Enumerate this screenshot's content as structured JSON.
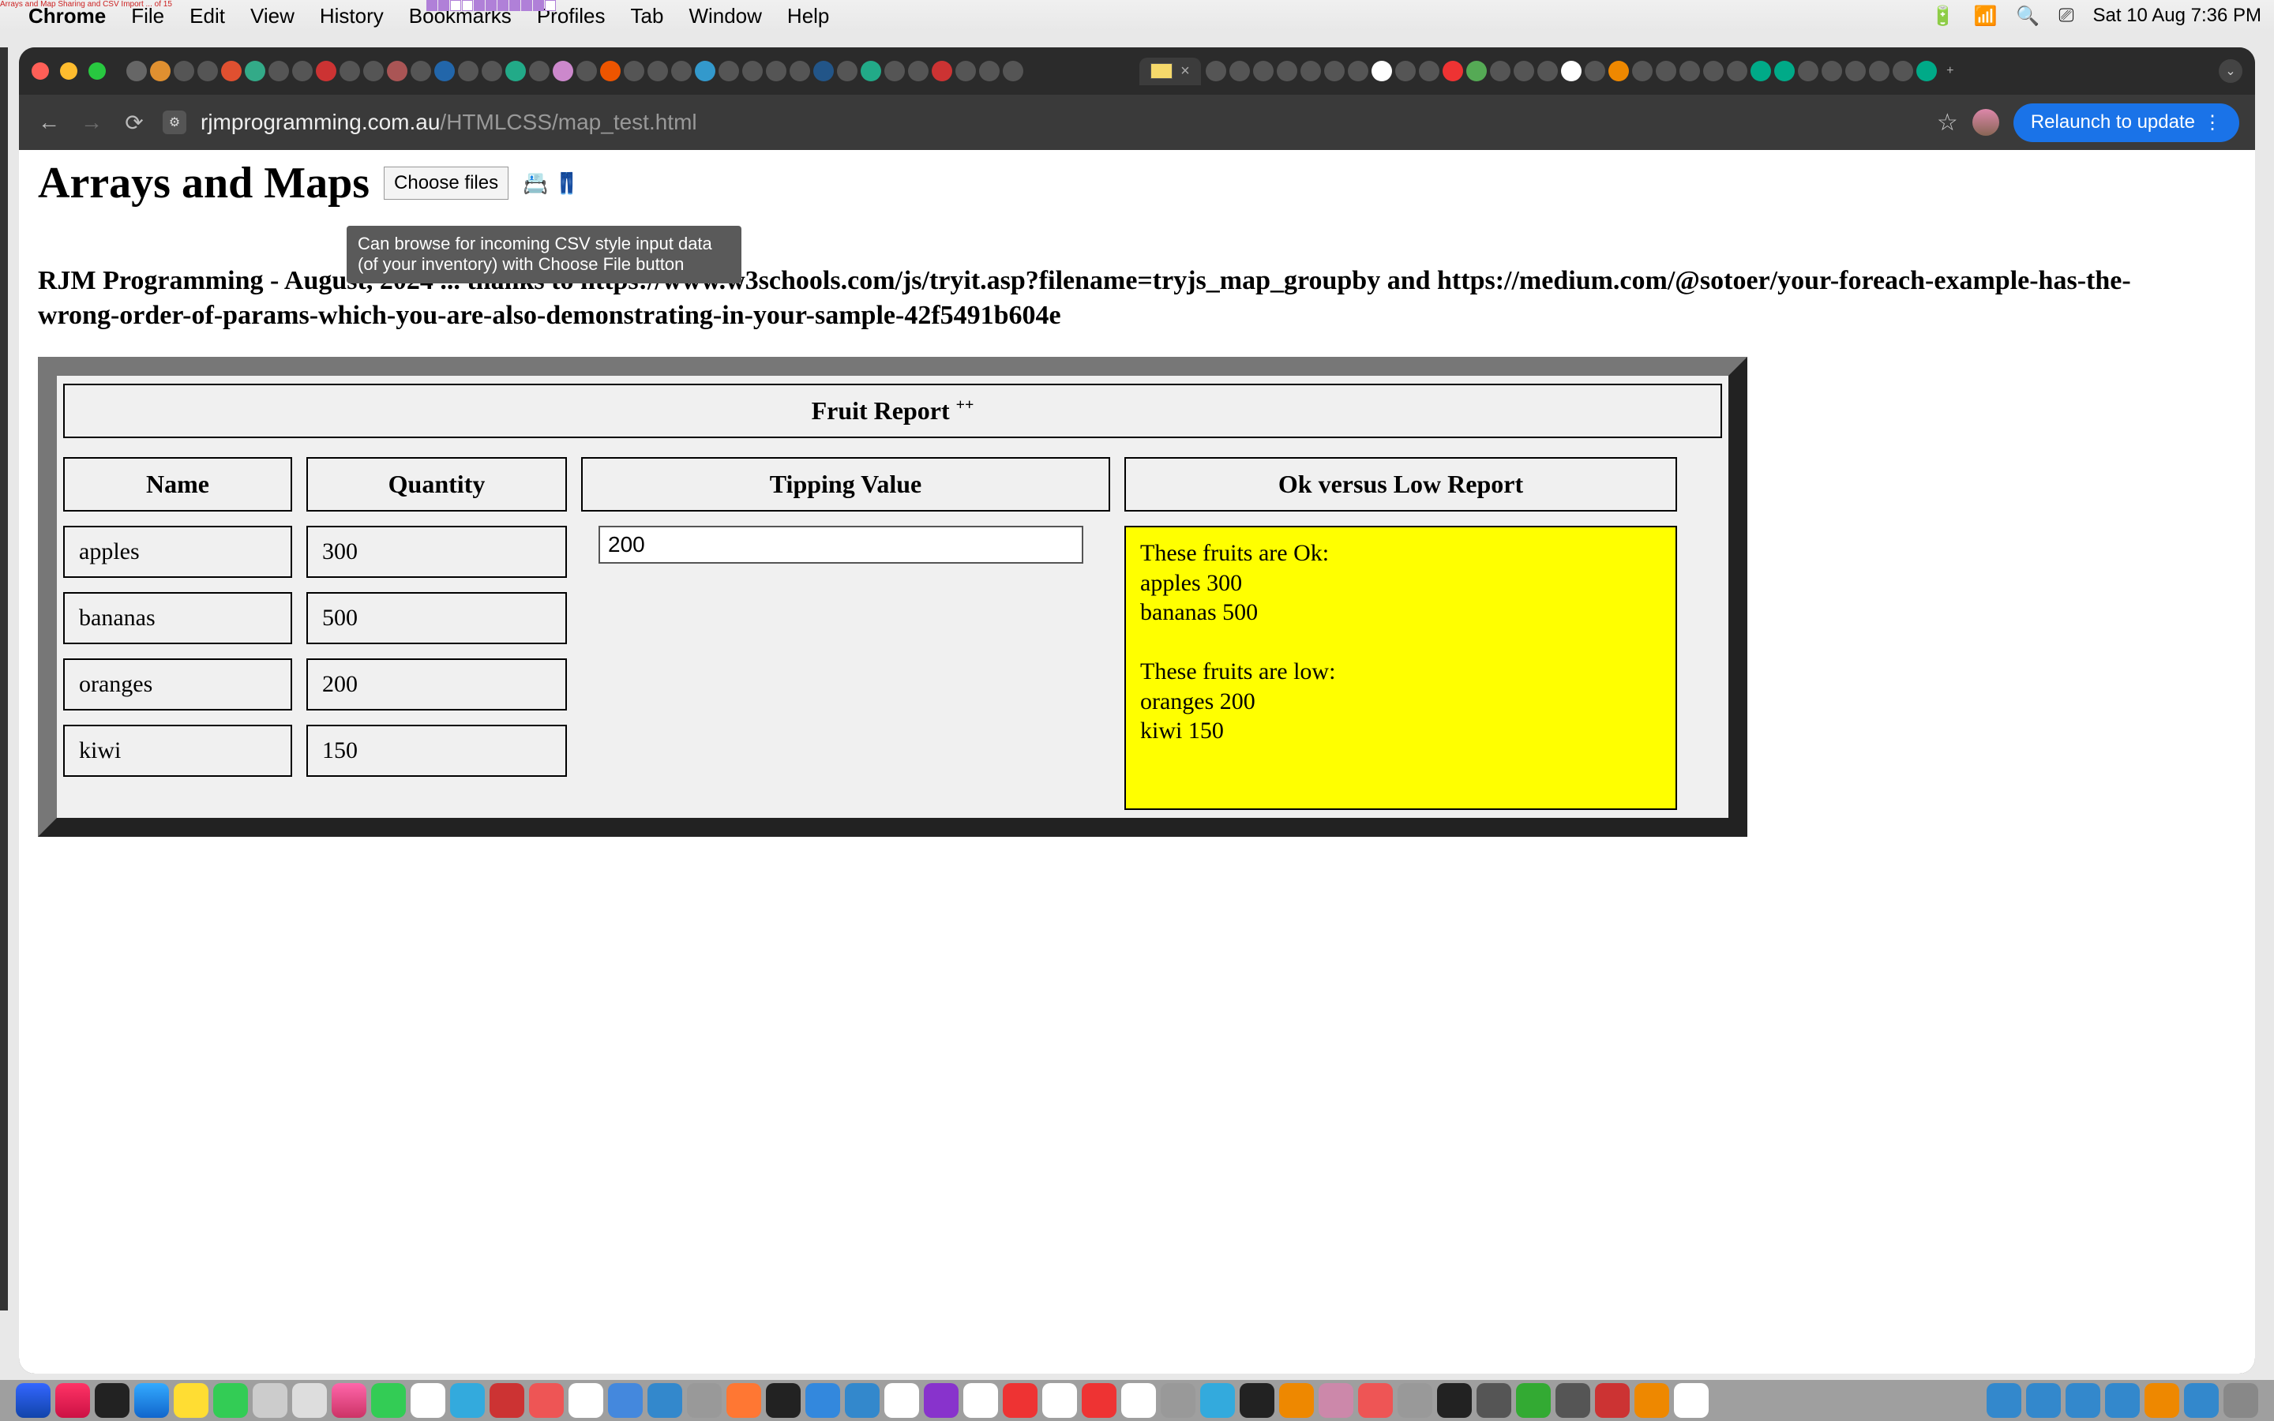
{
  "menubar": {
    "tiny": "Arrays and Map Sharing and CSV Import ... of 15",
    "items": [
      "Chrome",
      "File",
      "Edit",
      "View",
      "History",
      "Bookmarks",
      "Profiles",
      "Tab",
      "Window",
      "Help"
    ],
    "clock": "Sat 10 Aug  7:36 PM"
  },
  "browser": {
    "url_host": "rjmprogramming.com.au",
    "url_path": "/HTMLCSS/map_test.html",
    "relaunch": "Relaunch to update",
    "active_tab_close": "×"
  },
  "page": {
    "title": "Arrays and Maps",
    "choose_files": "Choose files",
    "emoji": "📇 👖",
    "tooltip": "Can browse for incoming CSV style input data (of your inventory) with Choose File button",
    "subtitle": "RJM Programming - August, 2024 ... thanks to https://www.w3schools.com/js/tryit.asp?filename=tryjs_map_groupby and https://medium.com/@sotoer/your-foreach-example-has-the-wrong-order-of-params-which-you-are-also-demonstrating-in-your-sample-42f5491b604e",
    "panel_title": "Fruit Report",
    "panel_title_sup": "++",
    "headers": {
      "name": "Name",
      "qty": "Quantity",
      "tip": "Tipping Value",
      "report": "Ok versus Low Report"
    },
    "rows": [
      {
        "name": "apples",
        "qty": "300"
      },
      {
        "name": "bananas",
        "qty": "500"
      },
      {
        "name": "oranges",
        "qty": "200"
      },
      {
        "name": "kiwi",
        "qty": "150"
      }
    ],
    "tipping_value": "200",
    "report_text": "These fruits are Ok:\napples 300\nbananas 500\n\nThese fruits are low:\noranges 200\nkiwi 150"
  }
}
